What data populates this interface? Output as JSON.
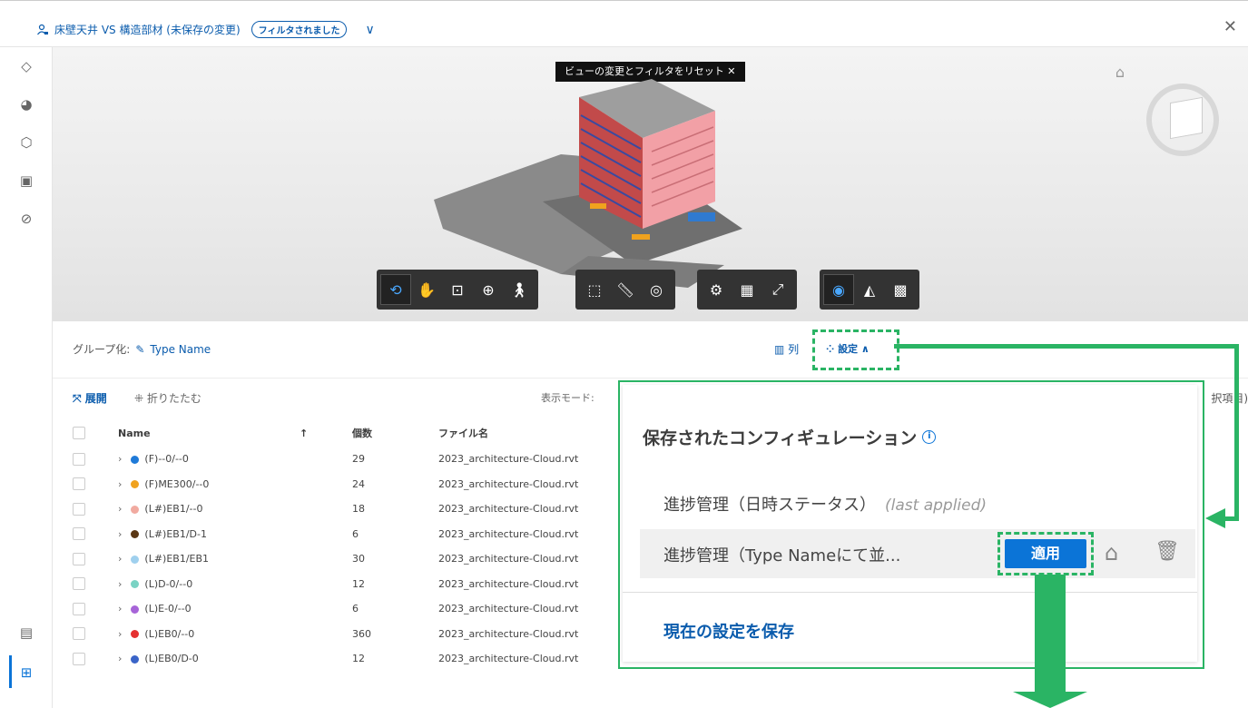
{
  "topbar": {
    "title": "床壁天井 VS 構造部材 (未保存の変更)",
    "badge": "フィルタされました",
    "chevron": "∨",
    "close": "✕"
  },
  "viewer": {
    "reset_label": "ビューの変更とフィルタをリセット ✕"
  },
  "panel": {
    "group_label": "グループ化:",
    "group_value": "Type Name",
    "columns_label": "列",
    "settings_label": "設定 ∧",
    "expand_label": "展開",
    "collapse_label": "折りたたむ",
    "display_mode_label": "表示モード:",
    "right_cut_label": "択項目)",
    "columns": {
      "name": "Name",
      "count": "個数",
      "file": "ファイル名",
      "sort": "↑"
    },
    "rows": [
      {
        "name": "(F)--0/--0",
        "count": "29",
        "file": "2023_architecture-Cloud.rvt",
        "color": "#1f7ad8"
      },
      {
        "name": "(F)ME300/--0",
        "count": "24",
        "file": "2023_architecture-Cloud.rvt",
        "color": "#f0a21e"
      },
      {
        "name": "(L#)EB1/--0",
        "count": "18",
        "file": "2023_architecture-Cloud.rvt",
        "color": "#f1aaa0"
      },
      {
        "name": "(L#)EB1/D-1",
        "count": "6",
        "file": "2023_architecture-Cloud.rvt",
        "color": "#5a3714"
      },
      {
        "name": "(L#)EB1/EB1",
        "count": "30",
        "file": "2023_architecture-Cloud.rvt",
        "color": "#9fd0ee"
      },
      {
        "name": "(L)D-0/--0",
        "count": "12",
        "file": "2023_architecture-Cloud.rvt",
        "color": "#7ad3c4"
      },
      {
        "name": "(L)E-0/--0",
        "count": "6",
        "file": "2023_architecture-Cloud.rvt",
        "color": "#a764d8"
      },
      {
        "name": "(L)EB0/--0",
        "count": "360",
        "file": "2023_architecture-Cloud.rvt",
        "color": "#e53030"
      },
      {
        "name": "(L)EB0/D-0",
        "count": "12",
        "file": "2023_architecture-Cloud.rvt",
        "color": "#3a64c8"
      }
    ]
  },
  "popup": {
    "title": "保存されたコンフィギュレーション",
    "info": "i",
    "config1": "進捗管理（日時ステータス）",
    "config1_note": "(last applied)",
    "config2": "進捗管理（Type Nameにて並...",
    "apply": "適用",
    "save_current": "現在の設定を保存"
  },
  "colors": {
    "accent": "#0b74d7",
    "highlight": "#2ab464"
  }
}
